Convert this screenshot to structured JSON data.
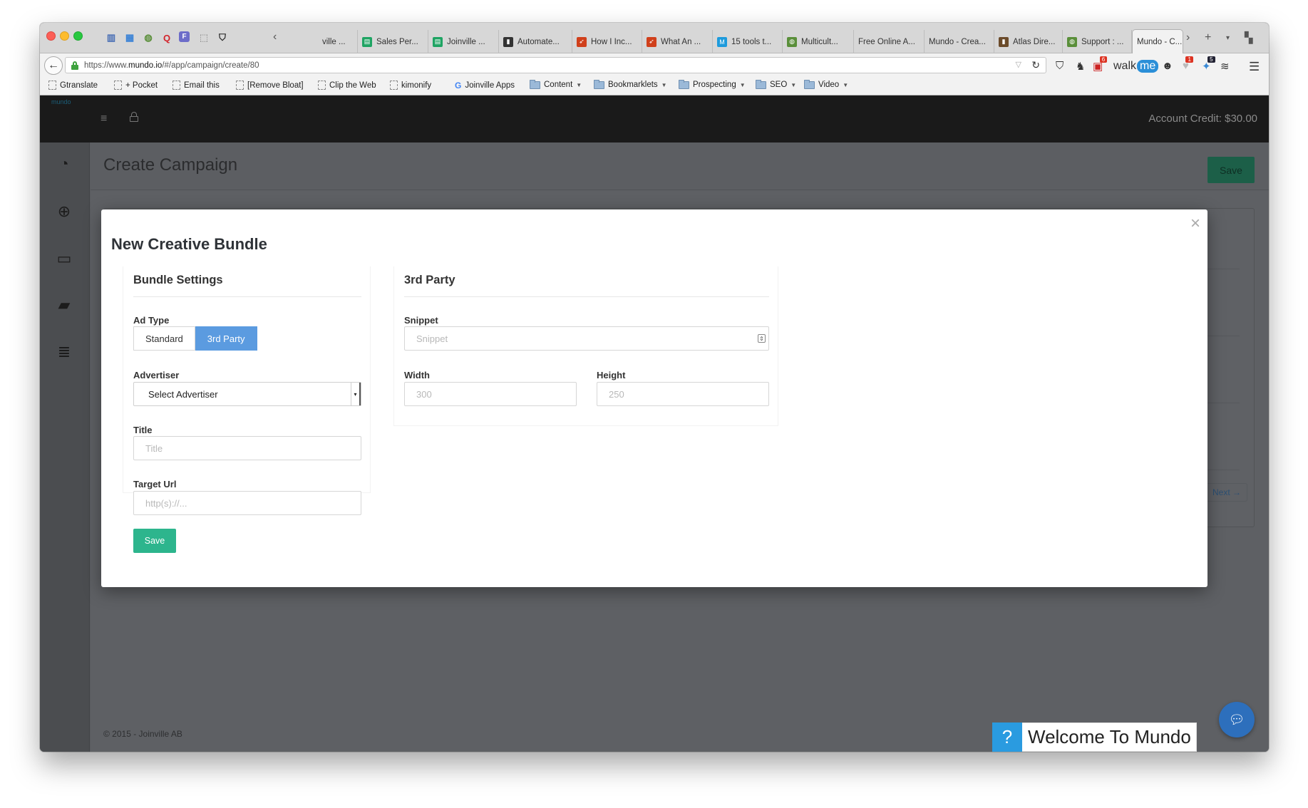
{
  "browser": {
    "tabs": [
      {
        "label": "ville ...",
        "icon": "generic-icon",
        "color": "#999999"
      },
      {
        "label": "Sales Per...",
        "icon": "sheets-icon",
        "color": "#1fa463"
      },
      {
        "label": "Joinville ...",
        "icon": "sheets-icon",
        "color": "#1fa463"
      },
      {
        "label": "Automate...",
        "icon": "chart-icon",
        "color": "#333333"
      },
      {
        "label": "How I Inc...",
        "icon": "rocket-icon",
        "color": "#d0401b"
      },
      {
        "label": "What An ...",
        "icon": "rocket-icon",
        "color": "#d0401b"
      },
      {
        "label": "15 tools t...",
        "icon": "m-icon",
        "color": "#1e9bdc"
      },
      {
        "label": "Multicult...",
        "icon": "globe-icon",
        "color": "#5a8f3a"
      },
      {
        "label": "Free Online A...",
        "icon": "none",
        "color": "#999999"
      },
      {
        "label": "Mundo - Crea...",
        "icon": "none",
        "color": "#999999"
      },
      {
        "label": "Atlas Dire...",
        "icon": "book-icon",
        "color": "#6b4b2a"
      },
      {
        "label": "Support : ...",
        "icon": "globe-icon",
        "color": "#5a8f3a"
      },
      {
        "label": "Mundo - C...",
        "icon": "none",
        "color": "#999999",
        "active": true
      }
    ],
    "url": "https://www.mundo.io/#/app/campaign/create/80",
    "url_prefix": "https://www.",
    "url_domain": "mundo.io",
    "url_path": "/#/app/campaign/create/80",
    "ext_badge_1": "1",
    "ext_badge_2": "5",
    "ext_badge_3": "6",
    "walkme_label_a": "walk",
    "walkme_label_b": "me",
    "bookmarks": [
      {
        "label": "Gtranslate",
        "type": "page"
      },
      {
        "label": "+ Pocket",
        "type": "page"
      },
      {
        "label": "Email this",
        "type": "page"
      },
      {
        "label": "[Remove Bloat]",
        "type": "page"
      },
      {
        "label": "Clip the Web",
        "type": "page"
      },
      {
        "label": "kimonify",
        "type": "page"
      },
      {
        "label": "Joinville Apps",
        "type": "google"
      },
      {
        "label": "Content",
        "type": "folder"
      },
      {
        "label": "Bookmarklets",
        "type": "folder"
      },
      {
        "label": "Prospecting",
        "type": "folder"
      },
      {
        "label": "SEO",
        "type": "folder"
      },
      {
        "label": "Video",
        "type": "folder"
      }
    ]
  },
  "app": {
    "logo": "mundo",
    "credit": "Account Credit: $30.00",
    "page_title": "Create Campaign",
    "header_save": "Save",
    "next_label": "Next →",
    "footer": "© 2015 - Joinville AB",
    "welcome": "Welcome To Mundo",
    "help_q": "?"
  },
  "modal": {
    "title": "New Creative Bundle",
    "bundle": {
      "heading": "Bundle Settings",
      "ad_type_label": "Ad Type",
      "ad_types": [
        "Standard",
        "3rd Party"
      ],
      "ad_type_selected": "3rd Party",
      "advertiser_label": "Advertiser",
      "advertiser_value": "Select Advertiser",
      "title_label": "Title",
      "title_placeholder": "Title",
      "target_label": "Target Url",
      "target_placeholder": "http(s)://...",
      "save_label": "Save"
    },
    "third_party": {
      "heading": "3rd Party",
      "snippet_label": "Snippet",
      "snippet_placeholder": "Snippet",
      "width_label": "Width",
      "width_placeholder": "300",
      "height_label": "Height",
      "height_placeholder": "250"
    }
  },
  "colors": {
    "accent_blue": "#5b9be0",
    "save_green": "#2db58d",
    "help_blue": "#2d6fbc"
  }
}
